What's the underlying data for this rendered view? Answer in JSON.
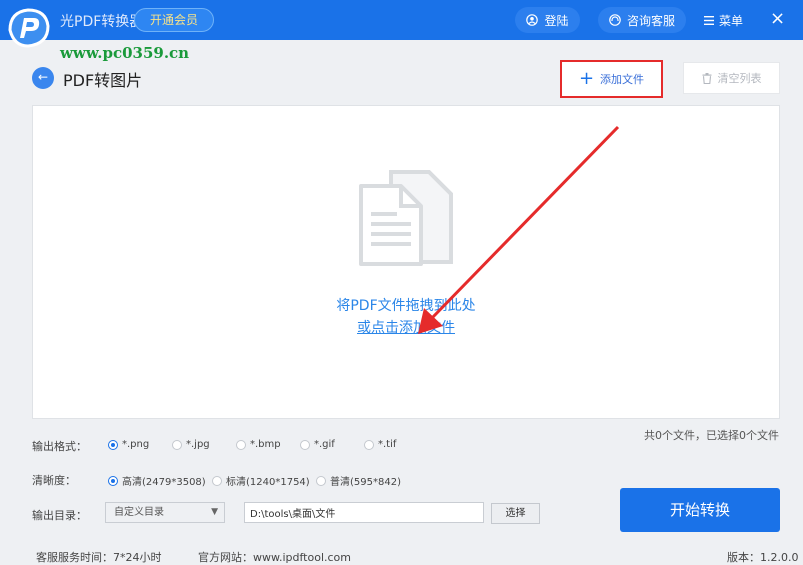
{
  "titlebar": {
    "app_name": "光PDF转换器",
    "vip_label": "开通会员",
    "login_label": "登陆",
    "consult_label": "咨询客服",
    "menu_label": "菜单",
    "close_glyph": "×"
  },
  "watermark": "www.pc0359.cn",
  "page": {
    "back_glyph": "←",
    "title": "PDF转图片"
  },
  "toolbar": {
    "add_file_label": "添加文件",
    "clear_list_label": "清空列表"
  },
  "drop_zone": {
    "line1": "将PDF文件拖拽到此处",
    "line2": "或点击添加文件"
  },
  "file_count": "共0个文件，已选择0个文件",
  "output_format": {
    "label": "输出格式：",
    "options": [
      "*.png",
      "*.jpg",
      "*.bmp",
      "*.gif",
      "*.tif"
    ],
    "selected": "*.png"
  },
  "clarity": {
    "label": "清晰度：",
    "options": [
      "高清(2479*3508)",
      "标清(1240*1754)",
      "普清(595*842)"
    ],
    "selected": "高清(2479*3508)"
  },
  "output_dir": {
    "label": "输出目录：",
    "select_value": "自定义目录",
    "path_value": "D:\\tools\\桌面\\文件",
    "choose_label": "选择"
  },
  "convert_label": "开始转换",
  "footer": {
    "service_hours": "客服服务时间：7*24小时",
    "website": "官方网站：www.ipdftool.com",
    "version": "版本：1.2.0.0"
  },
  "colors": {
    "brand_blue": "#1a72e8",
    "highlight_red": "#e52b2b",
    "link_blue": "#2b86e8",
    "watermark_green": "#1a9a3a"
  },
  "icons": [
    "app-logo",
    "user-icon",
    "headset-icon",
    "menu-icon",
    "close-icon",
    "back-arrow-icon",
    "plus-icon",
    "trash-icon",
    "document-icon",
    "dropdown-caret-icon"
  ]
}
